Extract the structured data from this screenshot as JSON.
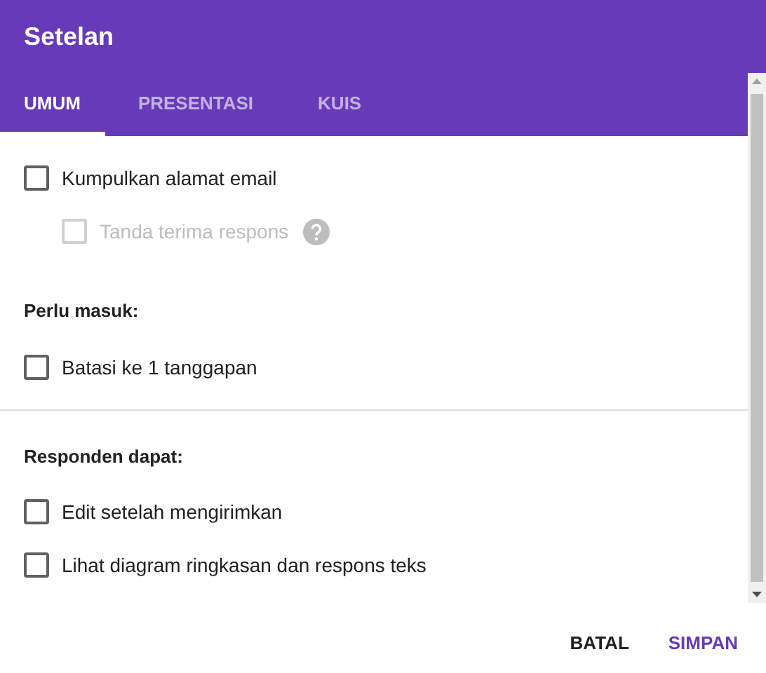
{
  "dialog": {
    "title": "Setelan"
  },
  "tabs": [
    {
      "label": "UMUM",
      "selected": true
    },
    {
      "label": "PRESENTASI",
      "selected": false
    },
    {
      "label": "KUIS",
      "selected": false
    }
  ],
  "sections": [
    {
      "items": [
        {
          "label": "Kumpulkan alamat email",
          "checked": false,
          "disabled": false,
          "children": [
            {
              "label": "Tanda terima respons",
              "checked": false,
              "disabled": true,
              "help": true
            }
          ]
        }
      ]
    },
    {
      "heading": "Perlu masuk:",
      "items": [
        {
          "label": "Batasi ke 1 tanggapan",
          "checked": false,
          "disabled": false
        }
      ]
    },
    {
      "heading": "Responden dapat:",
      "divider_before": true,
      "items": [
        {
          "label": "Edit setelah mengirimkan",
          "checked": false,
          "disabled": false
        },
        {
          "label": "Lihat diagram ringkasan dan respons teks",
          "checked": false,
          "disabled": false
        }
      ]
    }
  ],
  "buttons": [
    {
      "label": "BATAL",
      "kind": "secondary"
    },
    {
      "label": "SIMPAN",
      "kind": "primary"
    }
  ]
}
